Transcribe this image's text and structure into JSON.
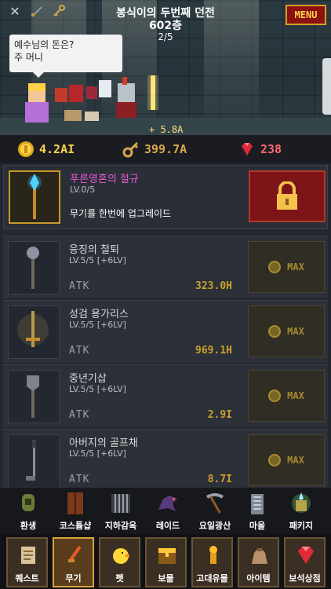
{
  "header": {
    "dungeon_title": "봉식이의 두번째 던전",
    "floor": "602층",
    "progress": "2/5",
    "menu_label": "MENU",
    "top_icons": [
      "close-icon",
      "sword-icon",
      "key-icon"
    ]
  },
  "speech": {
    "line1": "예수님의 돈은?",
    "line2": "주 머니"
  },
  "gain_text": "+ 5.8A",
  "currency": {
    "gold": "4.2AI",
    "keys": "399.7A",
    "gems": "238"
  },
  "featured": {
    "name": "푸른영혼의 절규",
    "level": "LV.0/5",
    "description": "무기를 한번에 업그레이드",
    "button_icon": "lock-icon"
  },
  "weapons": [
    {
      "name": "응징의 철퇴",
      "level": "LV.5/5 [+6LV]",
      "stat_label": "ATK",
      "stat_value": "323.0H",
      "button_label": "MAX"
    },
    {
      "name": "성검 용가리스",
      "level": "LV.5/5 [+6LV]",
      "stat_label": "ATK",
      "stat_value": "969.1H",
      "button_label": "MAX"
    },
    {
      "name": "중년기삽",
      "level": "LV.5/5 [+6LV]",
      "stat_label": "ATK",
      "stat_value": "2.9I",
      "button_label": "MAX"
    },
    {
      "name": "아버지의 골프채",
      "level": "LV.5/5 [+6LV]",
      "stat_label": "ATK",
      "stat_value": "8.7I",
      "button_label": "MAX"
    }
  ],
  "nav_top": [
    {
      "label": "환생",
      "icon": "rebirth-icon"
    },
    {
      "label": "코스튬샵",
      "icon": "wardrobe-icon"
    },
    {
      "label": "지하감옥",
      "icon": "prison-icon"
    },
    {
      "label": "레이드",
      "icon": "dragon-icon"
    },
    {
      "label": "요일광산",
      "icon": "pickaxe-icon"
    },
    {
      "label": "마을",
      "icon": "building-icon"
    },
    {
      "label": "패키지",
      "icon": "package-icon"
    }
  ],
  "nav_bottom": [
    {
      "label": "퀘스트",
      "icon": "scroll-icon"
    },
    {
      "label": "무기",
      "icon": "weapon-icon",
      "active": true
    },
    {
      "label": "펫",
      "icon": "chick-icon"
    },
    {
      "label": "보물",
      "icon": "treasure-icon"
    },
    {
      "label": "고대유물",
      "icon": "relic-icon"
    },
    {
      "label": "아이템",
      "icon": "bag-icon"
    },
    {
      "label": "보석상점",
      "icon": "gem-icon"
    }
  ],
  "colors": {
    "gold": "#ffd24a",
    "key": "#d8a84a",
    "gem": "#ff6a6a",
    "featured_name": "#e85ad6",
    "menu_bg": "#8b1111"
  }
}
